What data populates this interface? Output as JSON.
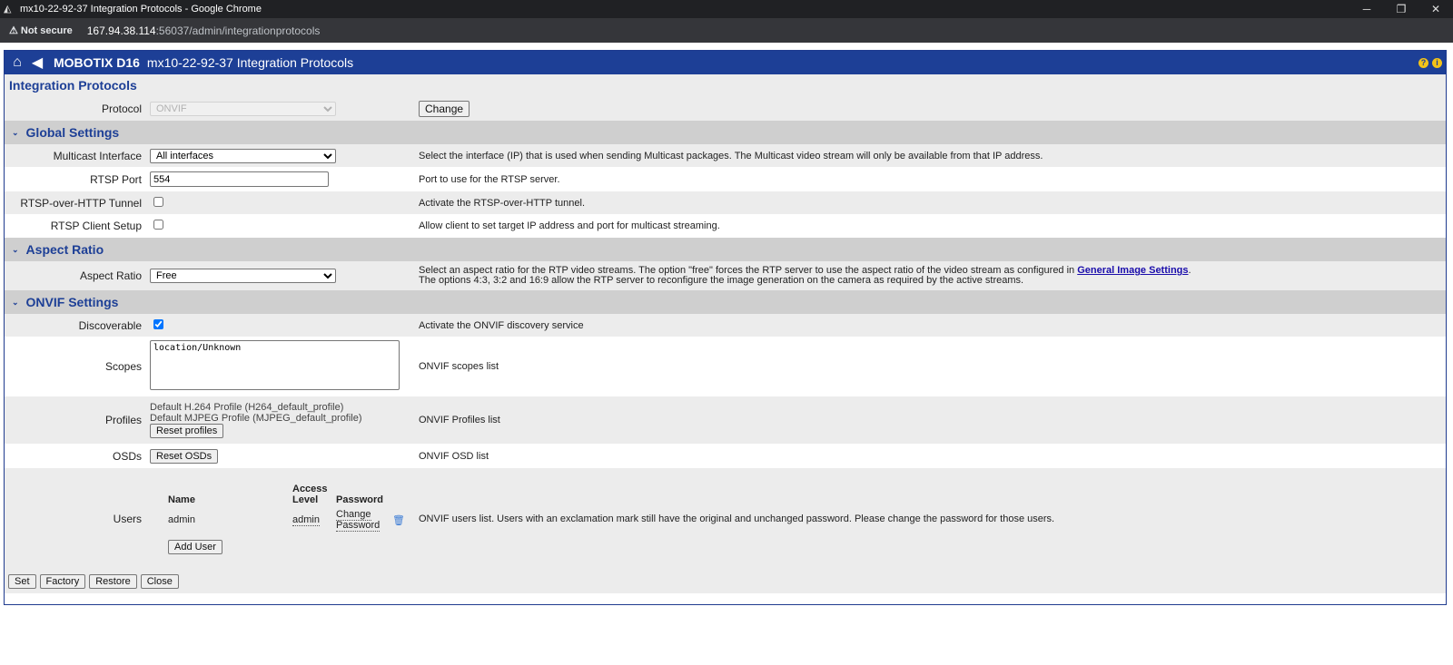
{
  "window": {
    "title": "mx10-22-92-37 Integration Protocols - Google Chrome",
    "controls": [
      "─",
      "❐",
      "✕"
    ]
  },
  "address": {
    "security": "Not secure",
    "host": "167.94.38.114",
    "path": ":56037/admin/integrationprotocols"
  },
  "header": {
    "brand": "MOBOTIX D16",
    "page": "mx10-22-92-37 Integration Protocols",
    "help_icon": "?",
    "info_icon": "i"
  },
  "page_title": "Integration Protocols",
  "protocol": {
    "label": "Protocol",
    "value": "ONVIF",
    "change_button": "Change"
  },
  "global": {
    "title": "Global Settings",
    "multicast_label": "Multicast Interface",
    "multicast_value": "All interfaces",
    "multicast_desc": "Select the interface (IP) that is used when sending Multicast packages. The Multicast video stream will only be available from that IP address.",
    "rtsp_port_label": "RTSP Port",
    "rtsp_port_value": "554",
    "rtsp_port_desc": "Port to use for the RTSP server.",
    "tunnel_label": "RTSP-over-HTTP Tunnel",
    "tunnel_desc": "Activate the RTSP-over-HTTP tunnel.",
    "client_label": "RTSP Client Setup",
    "client_desc": "Allow client to set target IP address and port for multicast streaming."
  },
  "aspect": {
    "title": "Aspect Ratio",
    "label": "Aspect Ratio",
    "value": "Free",
    "desc_1": "Select an aspect ratio for the RTP video streams. The option \"free\" forces the RTP server to use the aspect ratio of the video stream as configured in ",
    "desc_link": "General Image Settings",
    "desc_1_end": ".",
    "desc_2": "The options 4:3, 3:2 and 16:9 allow the RTP server to reconfigure the image generation on the camera as required by the active streams."
  },
  "onvif": {
    "title": "ONVIF Settings",
    "discoverable_label": "Discoverable",
    "discoverable_desc": "Activate the ONVIF discovery service",
    "scopes_label": "Scopes",
    "scopes_value": "location/Unknown",
    "scopes_desc": "ONVIF scopes list",
    "profiles_label": "Profiles",
    "profile_1": "Default H.264 Profile (H264_default_profile)",
    "profile_2": "Default MJPEG Profile (MJPEG_default_profile)",
    "reset_profiles": "Reset profiles",
    "profiles_desc": "ONVIF Profiles list",
    "osds_label": "OSDs",
    "reset_osds": "Reset OSDs",
    "osds_desc": "ONVIF OSD list",
    "users_label": "Users",
    "users_cols": {
      "name": "Name",
      "access_1": "Access",
      "access_2": "Level",
      "password": "Password"
    },
    "user": {
      "name": "admin",
      "level": "admin",
      "change_1": "Change",
      "change_2": "Password"
    },
    "add_user": "Add User",
    "users_desc": "ONVIF users list. Users with an exclamation mark still have the original and unchanged password. Please change the password for those users."
  },
  "footer": {
    "set": "Set",
    "factory": "Factory",
    "restore": "Restore",
    "close": "Close"
  }
}
